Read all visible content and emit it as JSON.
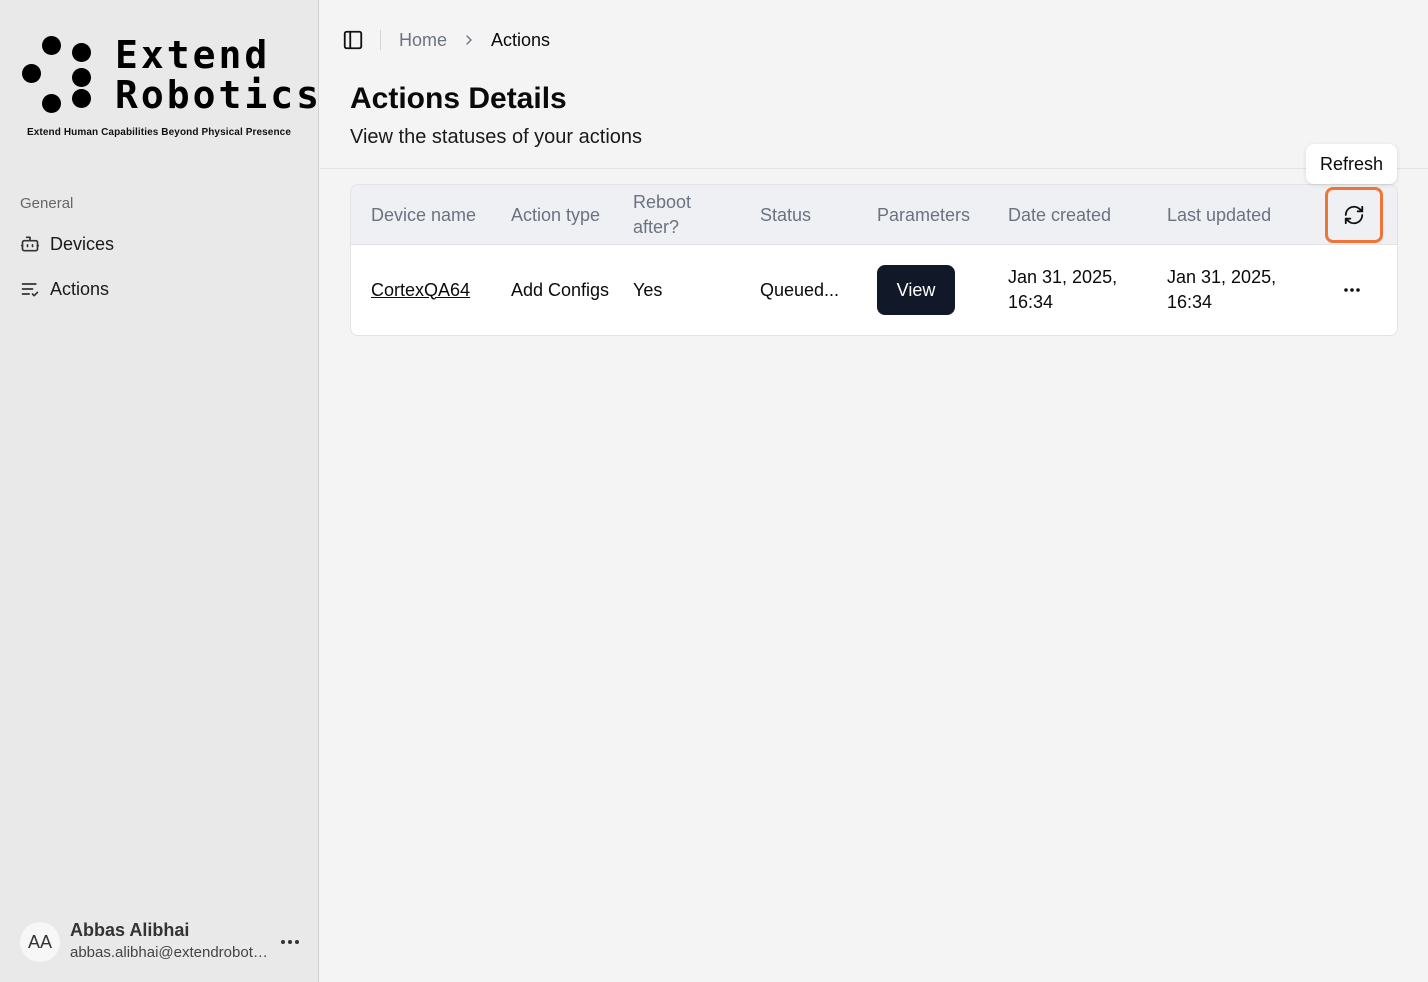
{
  "brand": {
    "line1": "Extend",
    "line2": "Robotics",
    "tagline": "Extend Human Capabilities Beyond Physical Presence"
  },
  "sidebar": {
    "group_label": "General",
    "items": [
      {
        "label": "Devices",
        "icon": "robot-icon"
      },
      {
        "label": "Actions",
        "icon": "list-check-icon"
      }
    ]
  },
  "user": {
    "initials": "AA",
    "name": "Abbas Alibhai",
    "email": "abbas.alibhai@extendrobotics.com"
  },
  "breadcrumb": {
    "home": "Home",
    "current": "Actions"
  },
  "page": {
    "title": "Actions Details",
    "subtitle": "View the statuses of your actions"
  },
  "table": {
    "headers": [
      "Device name",
      "Action type",
      "Reboot after?",
      "Status",
      "Parameters",
      "Date created",
      "Last updated"
    ],
    "rows": [
      {
        "device_name": "CortexQA64",
        "action_type": "Add Configs",
        "reboot_after": "Yes",
        "status": "Queued...",
        "parameters_button": "View",
        "date_created": "Jan 31, 2025, 16:34",
        "last_updated": "Jan 31, 2025, 16:34"
      }
    ]
  },
  "tooltip": {
    "refresh": "Refresh"
  },
  "colors": {
    "highlight": "#f0743a",
    "button_dark": "#111827"
  }
}
